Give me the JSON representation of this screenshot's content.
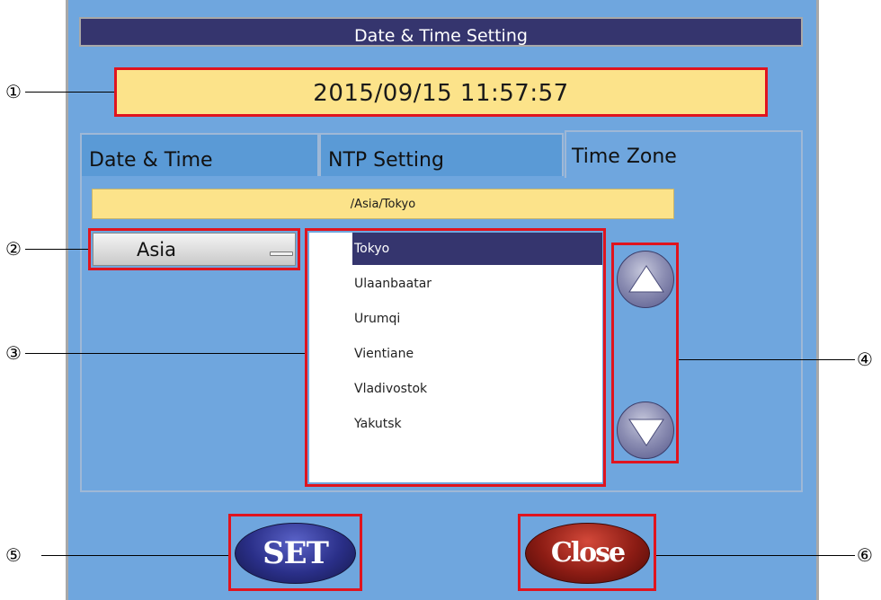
{
  "dialog": {
    "title": "Date & Time Setting",
    "current_datetime": "2015/09/15 11:57:57"
  },
  "tabs": [
    {
      "label": "Date & Time",
      "active": false
    },
    {
      "label": "NTP Setting",
      "active": false
    },
    {
      "label": "Time Zone",
      "active": true
    }
  ],
  "timezone": {
    "path": "/Asia/Tokyo",
    "region_selected": "Asia",
    "cities": [
      "Tokyo",
      "Ulaanbaatar",
      "Urumqi",
      "Vientiane",
      "Vladivostok",
      "Yakutsk"
    ],
    "selected_city": "Tokyo"
  },
  "buttons": {
    "set_label": "SET",
    "close_label": "Close",
    "scroll_up_icon": "triangle-up-icon",
    "scroll_down_icon": "triangle-down-icon"
  },
  "callouts": [
    "①",
    "②",
    "③",
    "④",
    "⑤",
    "⑥"
  ],
  "colors": {
    "dialog_bg": "#6fa6de",
    "title_bg": "#35356e",
    "field_bg": "#fce38a",
    "highlight_red": "#e0141e",
    "set_button": "#2a2f88",
    "close_button": "#8c1c14"
  }
}
